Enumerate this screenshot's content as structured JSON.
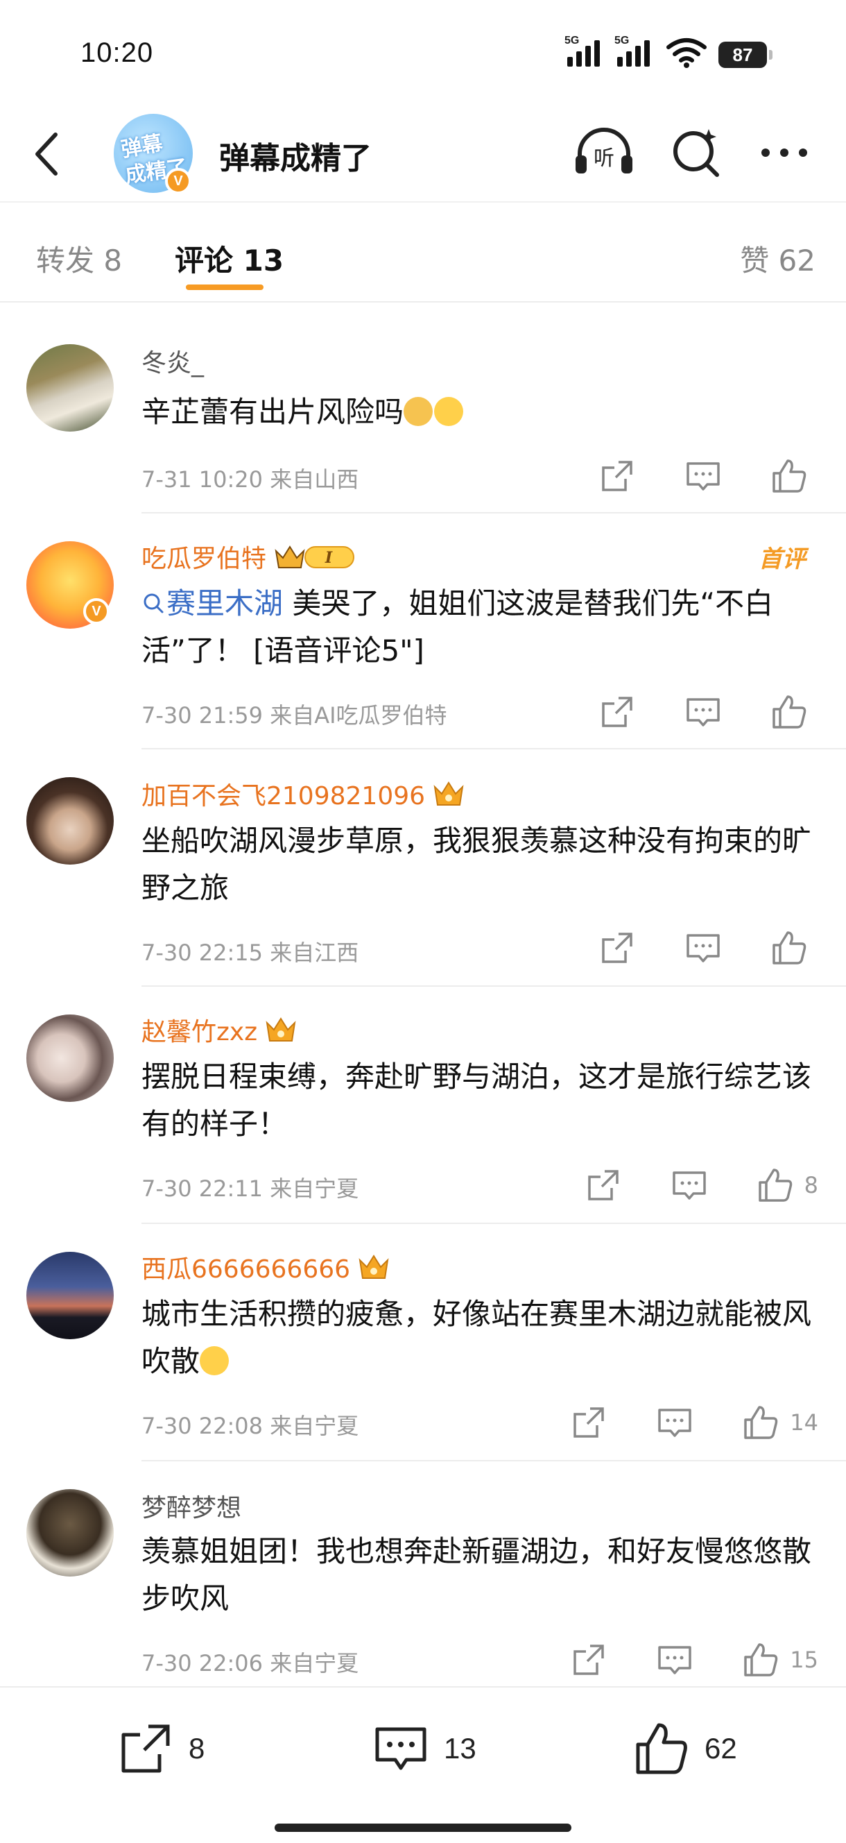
{
  "status": {
    "time": "10:20",
    "sig1": "5G",
    "sig2": "5G",
    "battery": "87"
  },
  "header": {
    "title": "弹幕成精了",
    "avatar_text_1": "弹幕",
    "avatar_text_2": "成精了",
    "verified": "V"
  },
  "tabs": {
    "repost": "转发 8",
    "comments": "评论 13",
    "likes": "赞 62"
  },
  "comments": [
    {
      "name": "冬炎_",
      "text": "辛芷蕾有出片风险吗",
      "time": "7-31 10:20",
      "location": "来自山西",
      "likes": ""
    },
    {
      "name": "吃瓜罗伯特",
      "level": "I",
      "badge": "首评",
      "topic": "赛里木湖",
      "text": " 美哭了，姐姐们这波是替我们先“不白活”了！ [语音评论5\"]",
      "time": "7-30 21:59",
      "location": "来自AI吃瓜罗伯特",
      "likes": ""
    },
    {
      "name": "加百不会飞2109821096",
      "text": "坐船吹湖风漫步草原，我狠狠羡慕这种没有拘束的旷野之旅",
      "time": "7-30 22:15",
      "location": "来自江西",
      "likes": ""
    },
    {
      "name": "赵馨竹zxz",
      "text": "摆脱日程束缚，奔赴旷野与湖泊，这才是旅行综艺该有的样子！",
      "time": "7-30 22:11",
      "location": "来自宁夏",
      "likes": "8"
    },
    {
      "name": "西瓜6666666666",
      "text": "城市生活积攒的疲惫，好像站在赛里木湖边就能被风吹散",
      "time": "7-30 22:08",
      "location": "来自宁夏",
      "likes": "14"
    },
    {
      "name": "梦醉梦想",
      "text": "羡慕姐姐团！我也想奔赴新疆湖边，和好友慢悠悠散步吹风",
      "time": "7-30 22:06",
      "location": "来自宁夏",
      "likes": "15"
    }
  ],
  "bottom": {
    "reposts": "8",
    "comments": "13",
    "likes": "62"
  },
  "colors": {
    "accent": "#f79b24",
    "name_orange": "#e8731f",
    "topic_blue": "#3b6ec6"
  },
  "icons": [
    "back-arrow-icon",
    "headphone-listen-icon",
    "search-ai-icon",
    "more-icon",
    "share-icon",
    "comment-icon",
    "like-icon",
    "crown-icon"
  ]
}
